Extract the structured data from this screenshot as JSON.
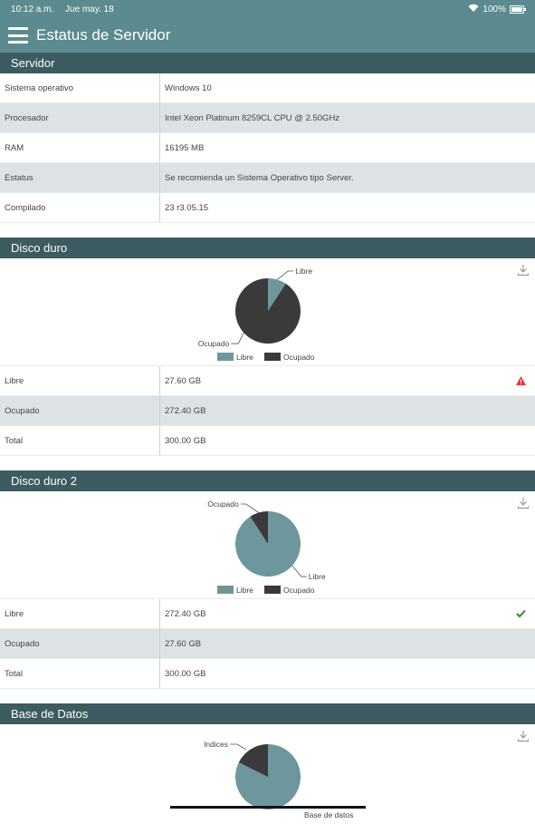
{
  "status_bar": {
    "time": "10:12 a.m.",
    "date": "Jue may. 18",
    "battery": "100%"
  },
  "app_bar": {
    "title": "Estatus de Servidor"
  },
  "colors": {
    "libre": "#6d979d",
    "ocupado": "#3a3a3a",
    "header": "#3c5c61",
    "appbar": "#5b8a8f",
    "warning": "#e53935",
    "ok": "#2e8b2e"
  },
  "servidor": {
    "header": "Servidor",
    "rows": [
      {
        "key": "Sistema operativo",
        "value": "Windows 10"
      },
      {
        "key": "Procesador",
        "value": "Intel Xeon Platinum 8259CL CPU @ 2.50GHz"
      },
      {
        "key": "RAM",
        "value": "16195 MB"
      },
      {
        "key": "Estatus",
        "value": "Se recomienda un Sistema Operativo tipo Server."
      },
      {
        "key": "Compilado",
        "value": "23 r3.05.15"
      }
    ]
  },
  "disco1": {
    "header": "Disco duro",
    "chart_data": {
      "type": "pie",
      "categories": [
        "Libre",
        "Ocupado"
      ],
      "values": [
        27.6,
        272.4
      ]
    },
    "legend": [
      "Libre",
      "Ocupado"
    ],
    "label_top": "Libre",
    "label_bottom": "Ocupado",
    "rows": [
      {
        "key": "Libre",
        "value": "27.60 GB",
        "icon": "warning-icon"
      },
      {
        "key": "Ocupado",
        "value": "272.40 GB"
      },
      {
        "key": "Total",
        "value": "300.00 GB"
      }
    ]
  },
  "disco2": {
    "header": "Disco duro 2",
    "chart_data": {
      "type": "pie",
      "categories": [
        "Libre",
        "Ocupado"
      ],
      "values": [
        272.4,
        27.6
      ]
    },
    "legend": [
      "Libre",
      "Ocupado"
    ],
    "label_top": "Ocupado",
    "label_bottom": "Libre",
    "rows": [
      {
        "key": "Libre",
        "value": "272.40 GB",
        "icon": "check-icon"
      },
      {
        "key": "Ocupado",
        "value": "27.60 GB"
      },
      {
        "key": "Total",
        "value": "300.00 GB"
      }
    ]
  },
  "base_datos": {
    "header": "Base de Datos",
    "label_top": "Indices",
    "label_bottom": "Base de datos"
  }
}
